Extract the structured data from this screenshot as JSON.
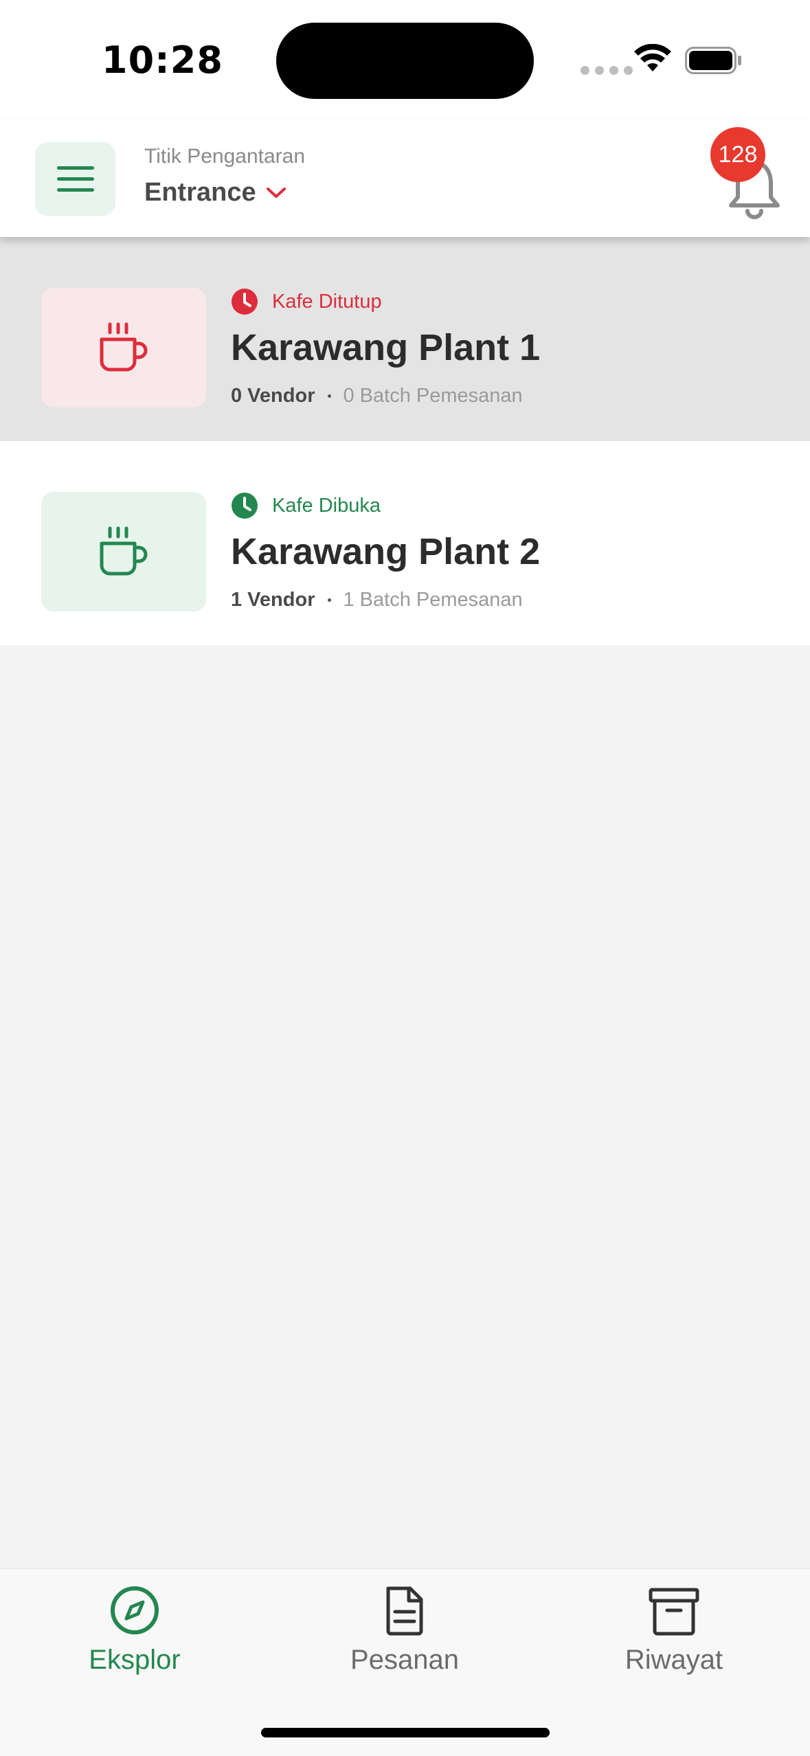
{
  "status_bar": {
    "time": "10:28"
  },
  "header": {
    "subtitle": "Titik Pengantaran",
    "location": "Entrance",
    "notification_count": "128"
  },
  "cafes": [
    {
      "status": "Kafe Ditutup",
      "status_type": "closed",
      "name": "Karawang Plant 1",
      "vendors": "0 Vendor",
      "batches": "0 Batch Pemesanan"
    },
    {
      "status": "Kafe Dibuka",
      "status_type": "open",
      "name": "Karawang Plant 2",
      "vendors": "1 Vendor",
      "batches": "1 Batch Pemesanan"
    }
  ],
  "bottom_nav": {
    "items": [
      {
        "label": "Eksplor",
        "icon": "compass-icon",
        "active": true
      },
      {
        "label": "Pesanan",
        "icon": "document-icon",
        "active": false
      },
      {
        "label": "Riwayat",
        "icon": "archive-icon",
        "active": false
      }
    ]
  },
  "colors": {
    "primary_green": "#23874f",
    "closed_red": "#dd2d3c",
    "badge_red": "#e8392f"
  }
}
